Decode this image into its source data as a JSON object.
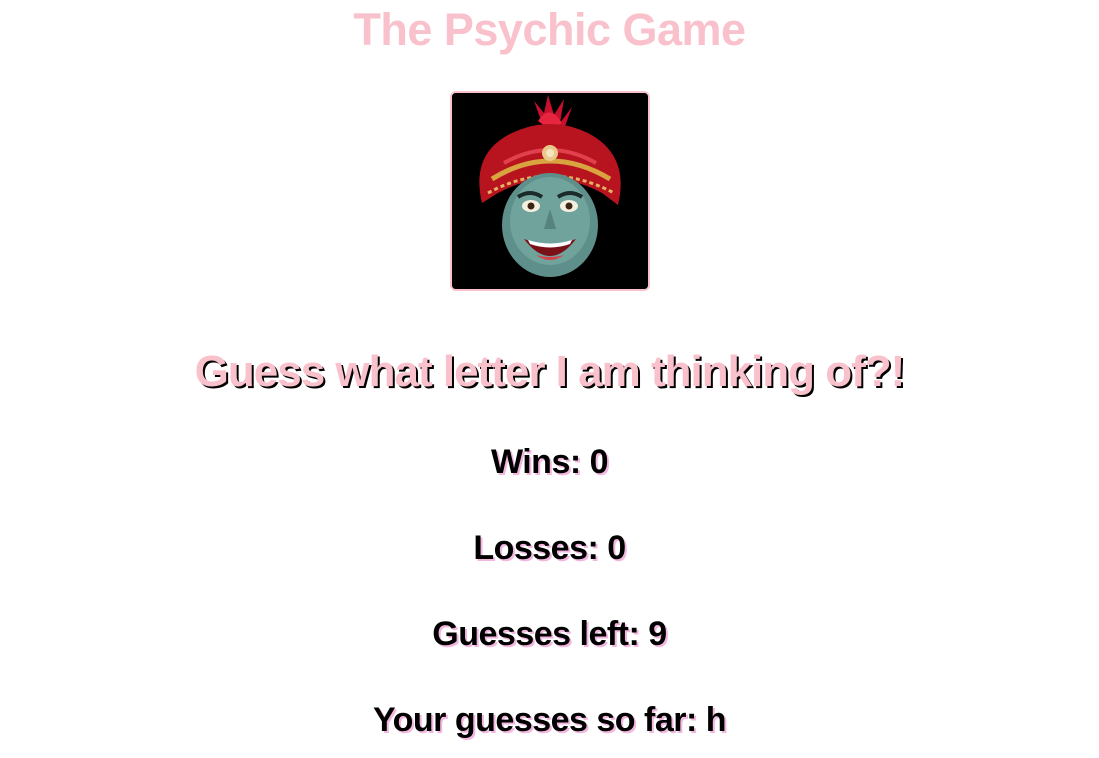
{
  "header": {
    "title": "The Psychic Game"
  },
  "portrait": {
    "icon": "psychic-fortune-teller-image"
  },
  "game": {
    "prompt": "Guess what letter I am thinking of?!",
    "wins_label": "Wins: ",
    "wins": "0",
    "losses_label": "Losses: ",
    "losses": "0",
    "guesses_left_label": "Guesses left: ",
    "guesses_left": "9",
    "guesses_so_far_label": "Your guesses so far: ",
    "guesses_so_far": "h"
  },
  "colors": {
    "accent_pink": "#f9c1cb",
    "shadow_lavender": "#f2b6df",
    "text": "#000000",
    "background": "#ffffff"
  }
}
